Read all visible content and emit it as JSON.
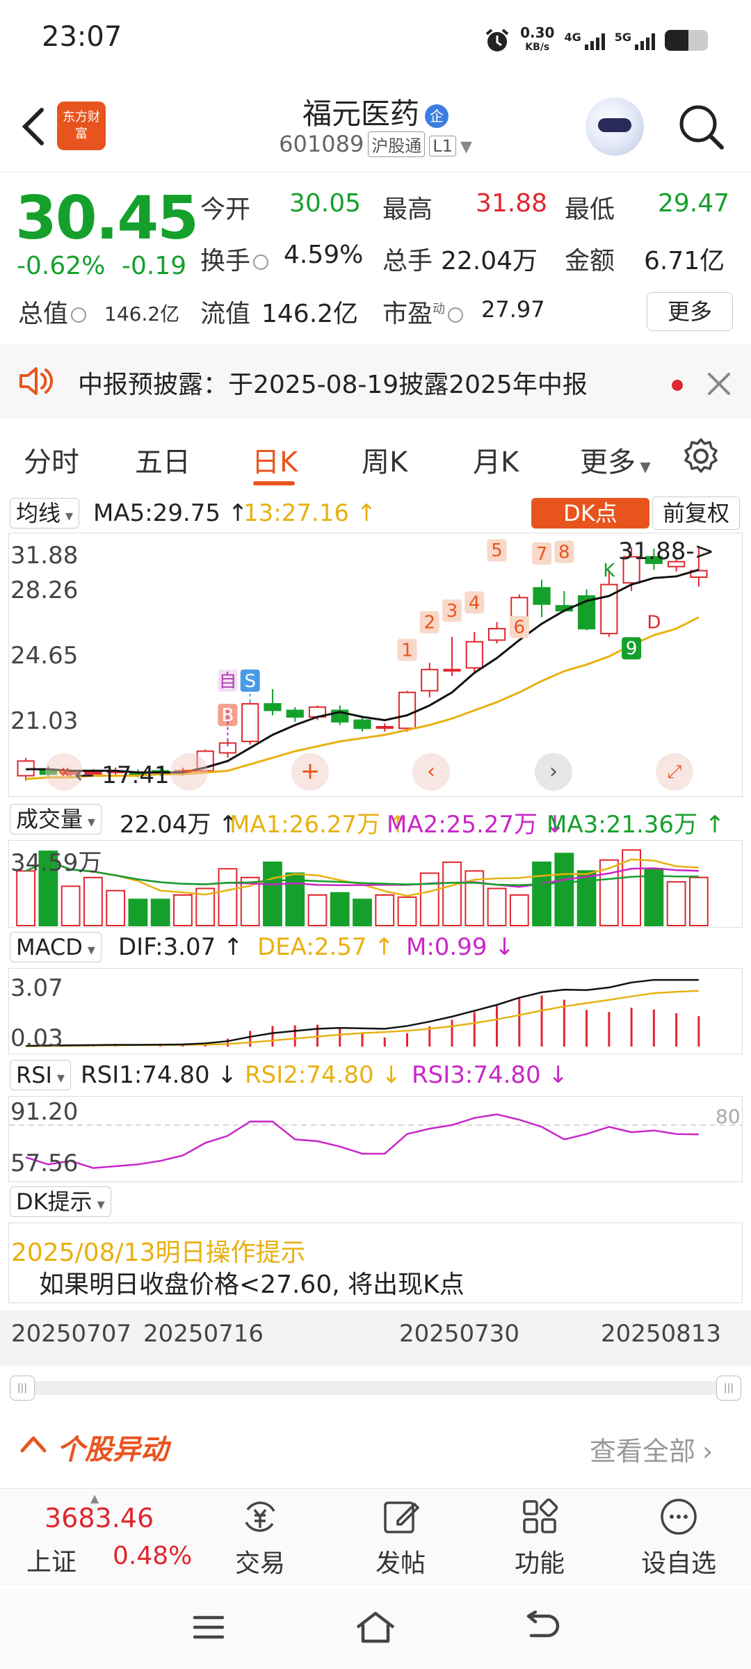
{
  "status_bar": {
    "time": "23:07",
    "net_speed": "0.30",
    "net_unit": "KB/s",
    "sim1": "4G",
    "sim2": "5G"
  },
  "header": {
    "brand": "东方财富",
    "stock_name": "福元医药",
    "stock_badge": "企",
    "stock_code": "601089",
    "tag_connect": "沪股通",
    "tag_level": "L1"
  },
  "quote": {
    "price": "30.45",
    "change_pct": "-0.62%",
    "change_abs": "-0.19",
    "open_label": "今开",
    "open": "30.05",
    "high_label": "最高",
    "high": "31.88",
    "low_label": "最低",
    "low": "29.47",
    "turnover_label": "换手",
    "turnover": "4.59%",
    "volume_label": "总手",
    "volume": "22.04万",
    "amount_label": "金额",
    "amount": "6.71亿",
    "mktcap_label": "总值",
    "mktcap": "146.2亿",
    "float_label": "流值",
    "float_cap": "146.2亿",
    "pe_label": "市盈",
    "pe_sup": "动",
    "pe": "27.97",
    "more_label": "更多"
  },
  "notice": {
    "text": "中报预披露：于2025-08-19披露2025年中报"
  },
  "tabs": [
    "分时",
    "五日",
    "日K",
    "周K",
    "月K",
    "更多"
  ],
  "active_tab": "日K",
  "chart_toolbar": {
    "ma_dropdown": "均线",
    "ma5": "MA5:29.75",
    "ma5_arrow": "↑",
    "ma_time": "13:27.16",
    "ma_time_arrow": "↑",
    "dk_button": "DK点",
    "adjust_button": "前复权"
  },
  "kline": {
    "y_labels": [
      "31.88",
      "28.26",
      "24.65",
      "21.03",
      "17.41"
    ],
    "high_marker": "31.88->",
    "low_marker": "17.41",
    "signal_labels": {
      "b": "B",
      "s": "S",
      "self": "自",
      "k": "K",
      "d": "D",
      "nine": "9"
    },
    "td_counts": [
      "1",
      "2",
      "3",
      "4",
      "5",
      "6",
      "7",
      "8"
    ]
  },
  "volume_panel": {
    "dropdown": "成交量",
    "value": "22.04万",
    "value_arrow": "↑",
    "ma1": "MA1:26.27万",
    "ma1_arrow": "↑",
    "ma2": "MA2:25.27万",
    "ma2_arrow": "↓",
    "ma3": "MA3:21.36万",
    "ma3_arrow": "↑",
    "y_max": "34.59万"
  },
  "macd_panel": {
    "dropdown": "MACD",
    "dif": "DIF:3.07",
    "dif_arrow": "↑",
    "dea": "DEA:2.57",
    "dea_arrow": "↑",
    "m": "M:0.99",
    "m_arrow": "↓",
    "y_top": "3.07",
    "y_bottom": "0.03"
  },
  "rsi_panel": {
    "dropdown": "RSI",
    "rsi1": "RSI1:74.80",
    "rsi1_arrow": "↓",
    "rsi2": "RSI2:74.80",
    "rsi2_arrow": "↓",
    "rsi3": "RSI3:74.80",
    "rsi3_arrow": "↓",
    "y_top": "91.20",
    "y_bottom": "57.56",
    "ref_line": "80"
  },
  "dk_tip": {
    "dropdown": "DK提示",
    "title": "2025/08/13明日操作提示",
    "text": "如果明日收盘价格<27.60, 将出现K点"
  },
  "date_axis": [
    "20250707",
    "20250716",
    "20250730",
    "20250813"
  ],
  "movers": {
    "title": "个股异动",
    "view_all": "查看全部"
  },
  "bottom_nav": {
    "index_value": "3683.46",
    "index_name": "上证",
    "index_pct": "0.48%",
    "items": [
      "交易",
      "发帖",
      "功能",
      "设自选"
    ]
  },
  "colors": {
    "up": "#e0262e",
    "down": "#15a02c",
    "accent": "#e8541e",
    "ma_gold": "#e8b010",
    "ma_magenta": "#c826c8"
  },
  "chart_data": {
    "type": "candlestick",
    "ylim": [
      17.41,
      31.88
    ],
    "candles": [
      {
        "o": 17.9,
        "c": 18.8,
        "h": 19.0,
        "l": 17.6
      },
      {
        "o": 18.2,
        "c": 18.0,
        "h": 18.5,
        "l": 17.8
      },
      {
        "o": 18.0,
        "c": 18.1,
        "h": 18.3,
        "l": 17.8
      },
      {
        "o": 18.1,
        "c": 18.1,
        "h": 18.3,
        "l": 17.9
      },
      {
        "o": 18.1,
        "c": 18.2,
        "h": 18.4,
        "l": 17.9
      },
      {
        "o": 18.1,
        "c": 18.0,
        "h": 18.3,
        "l": 17.8
      },
      {
        "o": 18.2,
        "c": 18.1,
        "h": 18.4,
        "l": 17.9
      },
      {
        "o": 18.1,
        "c": 18.2,
        "h": 18.4,
        "l": 17.9
      },
      {
        "o": 18.2,
        "c": 19.4,
        "h": 19.5,
        "l": 18.1
      },
      {
        "o": 19.3,
        "c": 19.9,
        "h": 20.1,
        "l": 19.0
      },
      {
        "o": 20.0,
        "c": 22.3,
        "h": 22.4,
        "l": 19.8
      },
      {
        "o": 22.3,
        "c": 21.9,
        "h": 23.2,
        "l": 21.6
      },
      {
        "o": 21.9,
        "c": 21.5,
        "h": 22.1,
        "l": 21.2
      },
      {
        "o": 21.5,
        "c": 22.1,
        "h": 22.2,
        "l": 21.3
      },
      {
        "o": 21.9,
        "c": 21.2,
        "h": 22.2,
        "l": 21.0
      },
      {
        "o": 21.3,
        "c": 20.8,
        "h": 21.5,
        "l": 20.6
      },
      {
        "o": 20.9,
        "c": 20.9,
        "h": 21.1,
        "l": 20.6
      },
      {
        "o": 20.8,
        "c": 23.0,
        "h": 23.1,
        "l": 20.6
      },
      {
        "o": 23.1,
        "c": 24.4,
        "h": 24.8,
        "l": 22.7
      },
      {
        "o": 24.4,
        "c": 24.4,
        "h": 26.4,
        "l": 24.0
      },
      {
        "o": 24.5,
        "c": 26.1,
        "h": 26.7,
        "l": 24.2
      },
      {
        "o": 26.2,
        "c": 26.9,
        "h": 27.3,
        "l": 26.0
      },
      {
        "o": 27.2,
        "c": 28.8,
        "h": 29.0,
        "l": 27.0
      },
      {
        "o": 29.4,
        "c": 28.4,
        "h": 29.9,
        "l": 27.6
      },
      {
        "o": 28.3,
        "c": 28.0,
        "h": 29.2,
        "l": 27.9
      },
      {
        "o": 28.9,
        "c": 26.9,
        "h": 29.3,
        "l": 26.8
      },
      {
        "o": 26.6,
        "c": 29.6,
        "h": 30.5,
        "l": 26.4
      },
      {
        "o": 29.7,
        "c": 31.3,
        "h": 31.9,
        "l": 29.2
      },
      {
        "o": 31.3,
        "c": 30.9,
        "h": 31.8,
        "l": 30.5
      },
      {
        "o": 30.7,
        "c": 31.0,
        "h": 31.2,
        "l": 30.4
      },
      {
        "o": 30.05,
        "c": 30.45,
        "h": 31.88,
        "l": 29.47
      }
    ],
    "ma5": [
      18.3,
      18.3,
      18.2,
      18.2,
      18.2,
      18.1,
      18.1,
      18.1,
      18.4,
      18.8,
      19.6,
      20.4,
      21.0,
      21.5,
      21.8,
      21.5,
      21.3,
      21.6,
      22.2,
      23.0,
      24.2,
      25.1,
      26.2,
      27.2,
      28.0,
      28.6,
      28.9,
      29.6,
      30.0,
      30.1,
      30.5
    ],
    "ma_slow": [
      17.7,
      17.8,
      17.8,
      17.9,
      17.9,
      17.9,
      18.0,
      18.0,
      18.1,
      18.2,
      18.6,
      19.0,
      19.4,
      19.7,
      20.0,
      20.2,
      20.4,
      20.7,
      21.0,
      21.4,
      21.9,
      22.4,
      23.0,
      23.7,
      24.3,
      24.7,
      25.2,
      25.9,
      26.5,
      26.9,
      27.6
    ],
    "volume": [
      25,
      34,
      18,
      22,
      16,
      12,
      12,
      14,
      17,
      26,
      22,
      29,
      24,
      14,
      15,
      12,
      14,
      13,
      24,
      29,
      25,
      17,
      14,
      29,
      33,
      25,
      30,
      34.59,
      26,
      20,
      22.04
    ],
    "dif": [
      0.03,
      0.05,
      0.06,
      0.07,
      0.08,
      0.08,
      0.09,
      0.1,
      0.15,
      0.25,
      0.45,
      0.62,
      0.72,
      0.82,
      0.86,
      0.84,
      0.82,
      0.95,
      1.15,
      1.38,
      1.65,
      1.92,
      2.25,
      2.5,
      2.62,
      2.6,
      2.72,
      2.95,
      3.07,
      3.07,
      3.07
    ],
    "dea": [
      0.02,
      0.03,
      0.04,
      0.05,
      0.06,
      0.07,
      0.07,
      0.08,
      0.09,
      0.12,
      0.19,
      0.28,
      0.37,
      0.46,
      0.55,
      0.62,
      0.67,
      0.73,
      0.82,
      0.94,
      1.08,
      1.25,
      1.45,
      1.66,
      1.85,
      2.0,
      2.15,
      2.31,
      2.46,
      2.52,
      2.57
    ],
    "rsi": [
      62,
      58,
      60,
      56,
      57,
      58,
      60,
      63,
      70,
      74,
      82,
      82,
      72,
      71,
      68,
      64,
      64,
      75,
      78,
      80,
      84,
      86,
      83,
      79,
      72,
      75,
      79,
      76,
      77,
      75,
      74.8
    ]
  }
}
